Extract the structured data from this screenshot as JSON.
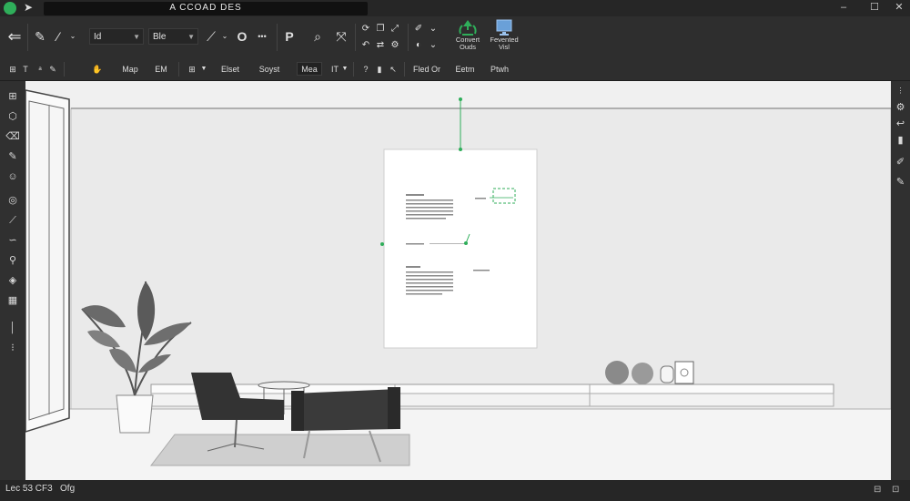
{
  "window": {
    "title": "A CCOAD DES",
    "back_arrow": "➜",
    "minimize": "–",
    "maximize": "☐",
    "close": "✕"
  },
  "toolbar1": {
    "layer_dropdown": "Id",
    "style_dropdown": "Ble",
    "circle_label": "O",
    "dots": "•••",
    "select_label": "P",
    "convert_label": "Convert\nOuds",
    "export_label": "Fevented\nVisl",
    "accent_color": "#2fae5a",
    "export_color": "#6aa0d8"
  },
  "toolbar2": {
    "items": [
      "Map",
      "EM",
      "Elset",
      "Soyst",
      "Mea",
      "IT",
      "Fled Or",
      "Eetm",
      "Ptwh"
    ]
  },
  "status": {
    "text": "Lec 53 CF3   Ofg"
  },
  "icons": {
    "left": [
      "grid-icon",
      "cube-icon",
      "eraser-icon",
      "pen-icon",
      "people-icon",
      "circle-icon",
      "ruler-icon",
      "link-icon",
      "wrench-icon",
      "bucket-icon",
      "calendar-icon",
      "line-icon",
      "dots-icon"
    ],
    "right": [
      "gear-icon",
      "curve-icon",
      "bar-chart-icon",
      "brush-icon",
      "pencil-icon"
    ]
  }
}
